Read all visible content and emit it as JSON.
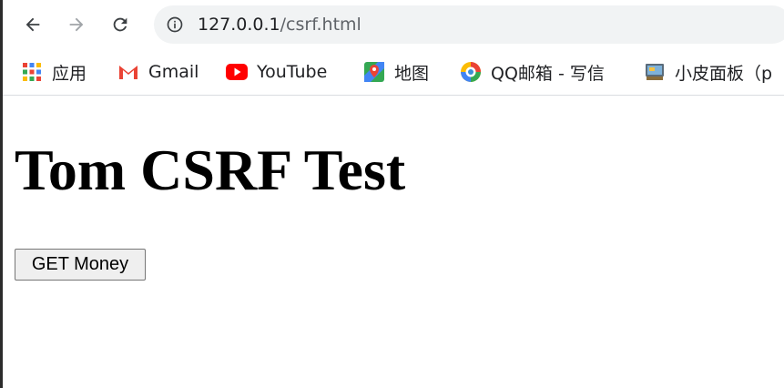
{
  "browser": {
    "url_host": "127.0.0.1",
    "url_path": "/csrf.html",
    "bookmarks": [
      {
        "label": "应用",
        "icon": "apps-grid-icon"
      },
      {
        "label": "Gmail",
        "icon": "gmail-icon"
      },
      {
        "label": "YouTube",
        "icon": "youtube-icon"
      },
      {
        "label": "地图",
        "icon": "maps-icon"
      },
      {
        "label": "QQ邮箱 - 写信",
        "icon": "qqmail-icon"
      },
      {
        "label": "小皮面板（p",
        "icon": "xp-panel-icon"
      }
    ]
  },
  "page": {
    "heading": "Tom CSRF Test",
    "button_label": "GET Money"
  },
  "colors": {
    "toolbar_bg": "#ffffff",
    "omnibox_bg": "#f1f3f4",
    "gmail_red": "#ea4335",
    "youtube_red": "#ff0000"
  }
}
